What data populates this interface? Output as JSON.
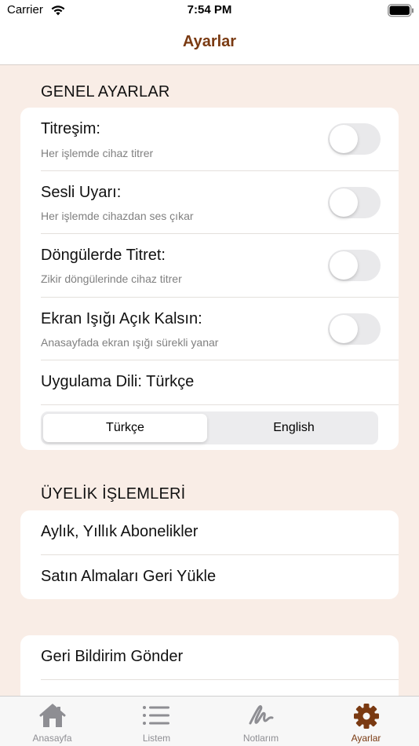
{
  "status_bar": {
    "carrier": "Carrier",
    "time": "7:54 PM"
  },
  "nav": {
    "title": "Ayarlar"
  },
  "general": {
    "header": "GENEL AYARLAR",
    "rows": [
      {
        "title": "Titreşim:",
        "subtitle": "Her işlemde cihaz titrer",
        "on": false
      },
      {
        "title": "Sesli Uyarı:",
        "subtitle": "Her işlemde cihazdan ses çıkar",
        "on": false
      },
      {
        "title": "Döngülerde Titret:",
        "subtitle": "Zikir döngülerinde cihaz titrer",
        "on": false
      },
      {
        "title": "Ekran Işığı Açık Kalsın:",
        "subtitle": "Anasayfada ekran ışığı sürekli yanar",
        "on": false
      }
    ],
    "language_label": "Uygulama Dili: Türkçe",
    "language_options": [
      "Türkçe",
      "English"
    ],
    "language_selected": "Türkçe"
  },
  "membership": {
    "header": "ÜYELİK İŞLEMLERİ",
    "items": [
      "Aylık, Yıllık Abonelikler",
      "Satın Almaları Geri Yükle"
    ]
  },
  "other": {
    "items": [
      "Geri Bildirim Gönder"
    ]
  },
  "tabs": [
    {
      "label": "Anasayfa",
      "icon": "home-icon",
      "active": false
    },
    {
      "label": "Listem",
      "icon": "list-icon",
      "active": false
    },
    {
      "label": "Notlarım",
      "icon": "scribble-icon",
      "active": false
    },
    {
      "label": "Ayarlar",
      "icon": "gear-icon",
      "active": true
    }
  ],
  "colors": {
    "accent": "#7a3a12",
    "background": "#f9ede6",
    "tab_inactive": "#8e8e93"
  }
}
